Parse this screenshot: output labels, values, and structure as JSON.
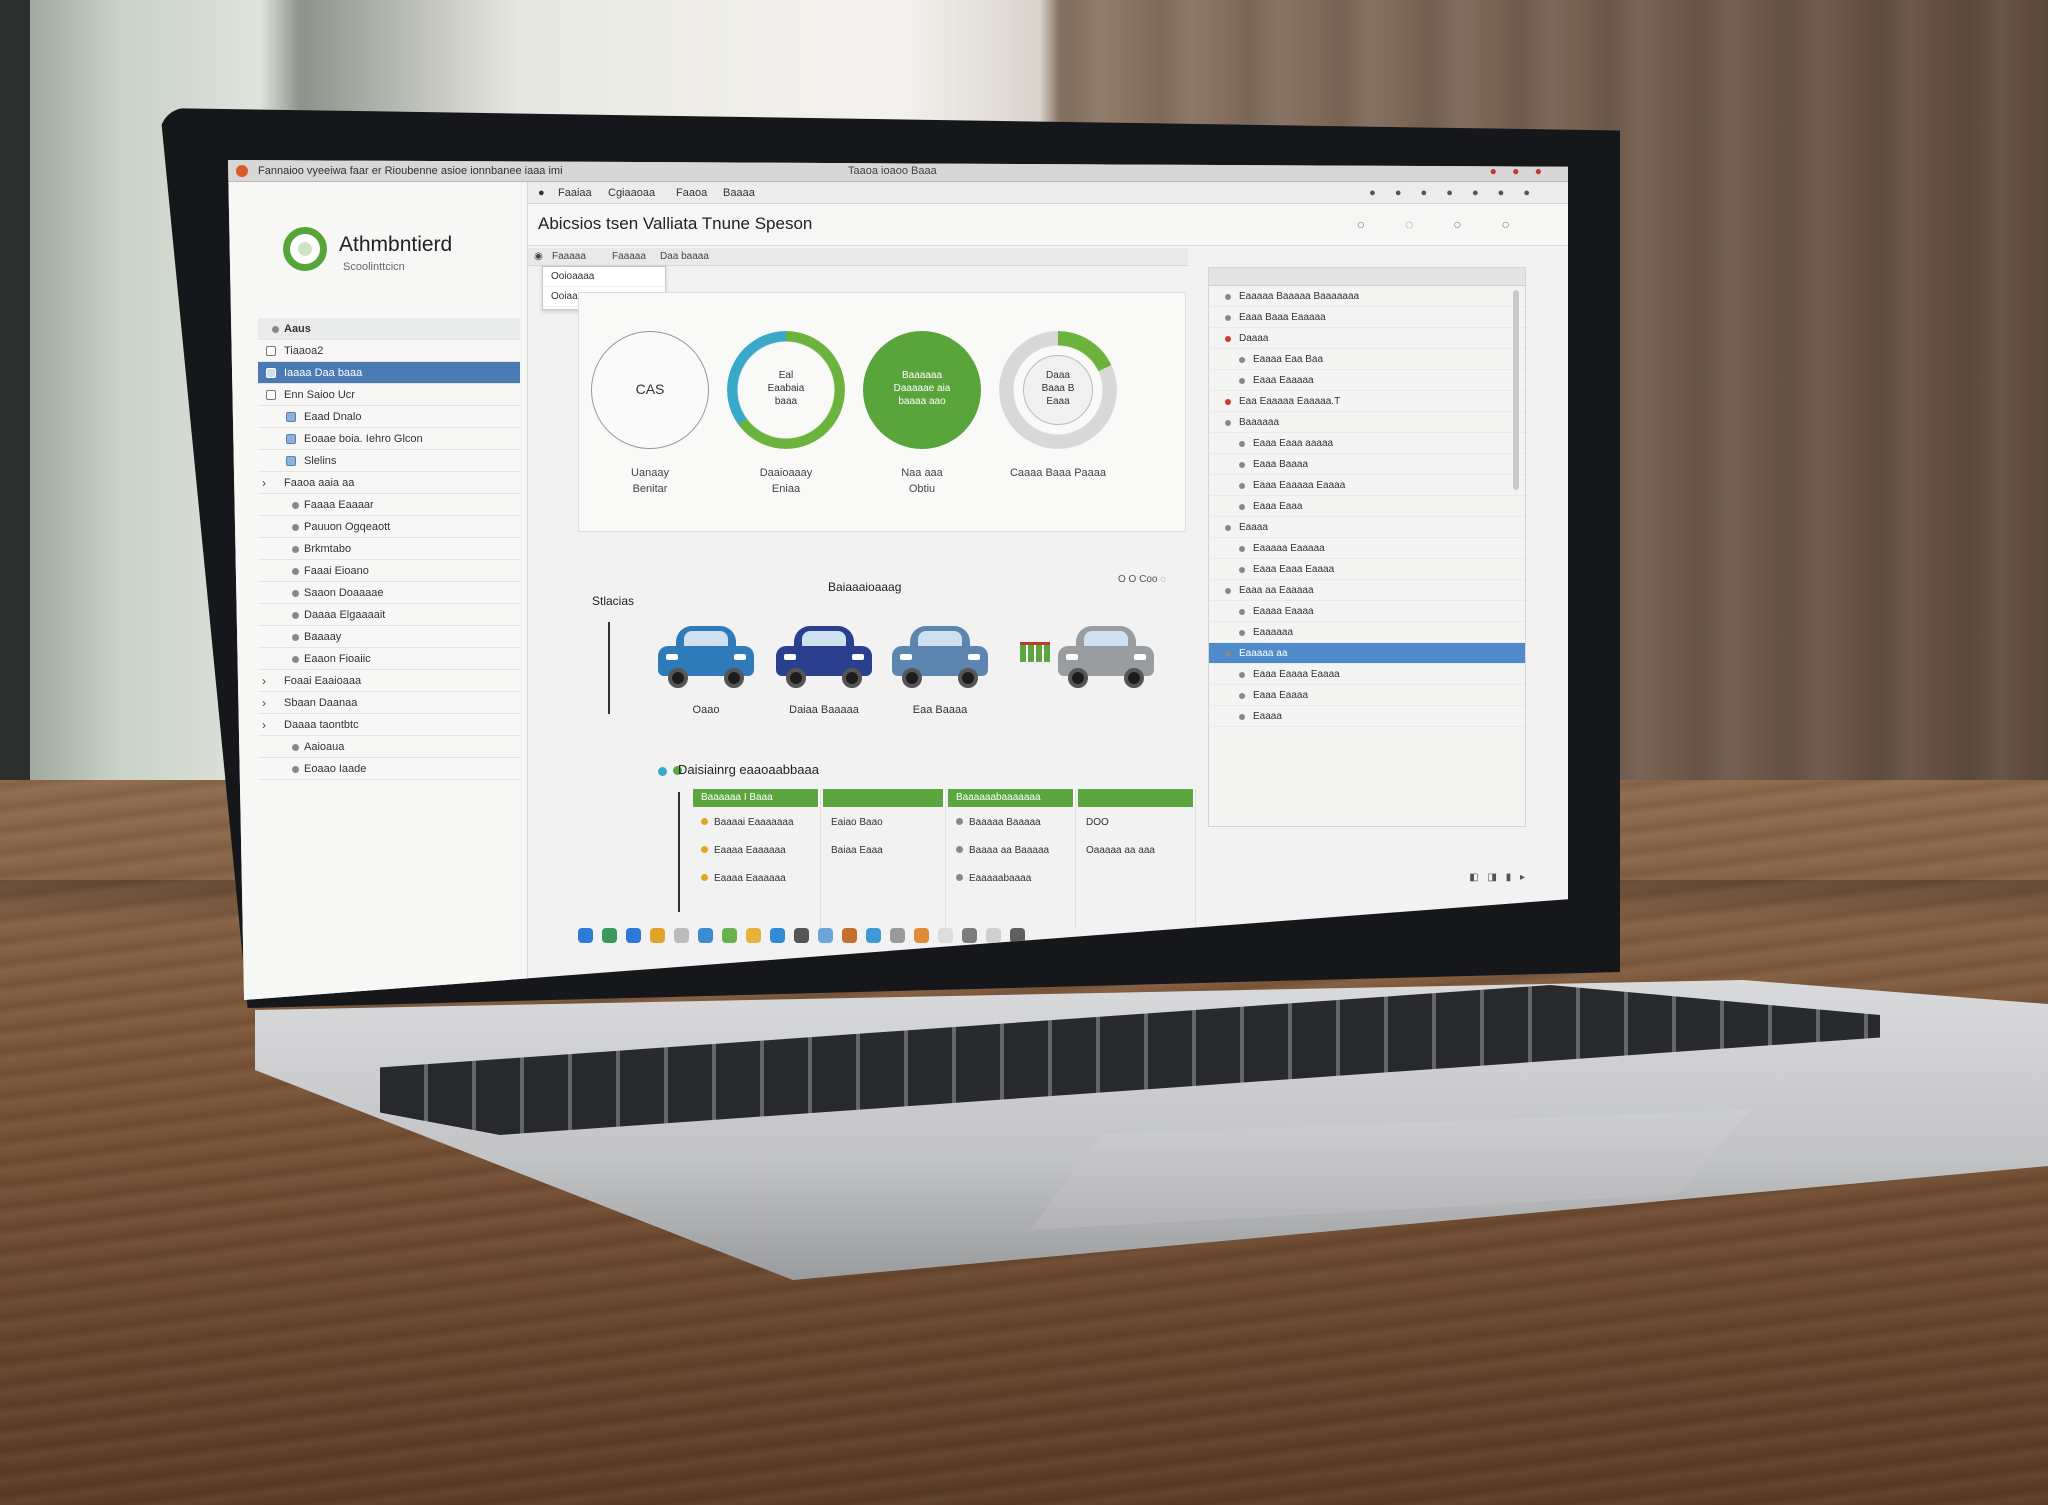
{
  "titlebar": {
    "left_text": "Fannaioo vyeeiwa faar er Rioubenne asioe ionnbanee iaaa imi",
    "center_text": "Taaoa ioaoo Baaa",
    "controls": "● ● ●"
  },
  "brand": {
    "title": "Athmbntierd",
    "subtitle": "Scoolinttcicn"
  },
  "sidebar": {
    "items": [
      {
        "label": "Aaus",
        "type": "head"
      },
      {
        "label": "Tiaaoa2",
        "type": "item"
      },
      {
        "label": "Iaaaa Daa baaa",
        "type": "selected"
      },
      {
        "label": "Enn Saioo Ucr",
        "type": "item"
      },
      {
        "label": "Eaad Dnalo",
        "type": "sub"
      },
      {
        "label": "Eoaae boia. Iehro Glcon",
        "type": "sub"
      },
      {
        "label": "Slelins",
        "type": "sub"
      },
      {
        "label": "Faaoa aaia aa",
        "type": "chev"
      },
      {
        "label": "Faaaa Eaaaar",
        "type": "bullet"
      },
      {
        "label": "Pauuon Ogqeaott",
        "type": "bullet"
      },
      {
        "label": "Brkmtabo",
        "type": "bullet"
      },
      {
        "label": "Faaai Eioano",
        "type": "bullet"
      },
      {
        "label": "Saaon Doaaaae",
        "type": "bullet"
      },
      {
        "label": "Daaaa Elgaaaait",
        "type": "bullet"
      },
      {
        "label": "Baaaay",
        "type": "bullet"
      },
      {
        "label": "Eaaon Fioaiic",
        "type": "bullet"
      },
      {
        "label": "Foaai Eaaioaaa",
        "type": "chev"
      },
      {
        "label": "Sbaan Daanaa",
        "type": "chev"
      },
      {
        "label": "Daaaa taontbtc",
        "type": "chev"
      },
      {
        "label": "Aaioaua",
        "type": "bullet"
      },
      {
        "label": "Eoaao Iaade",
        "type": "bullet"
      }
    ]
  },
  "tabs": [
    "Faaiaa",
    "Cgiaaoaa",
    "Faaoa",
    "Baaaa"
  ],
  "page_title": "Abicsios tsen Valliata Tnune Speson",
  "breadcrumb": [
    "Faaaaa",
    "Faaaaa",
    "Daa baaaa"
  ],
  "dropdown": {
    "items": [
      "Ooioaaaa",
      "Ooiaaaaaaa"
    ]
  },
  "rings": [
    {
      "center": "CAS",
      "caption_line1": "Uanaay",
      "caption_line2": "Benitar",
      "style": "outline",
      "color": "#9a9a9a",
      "value": 1.0
    },
    {
      "center": "Eal\nEaabaia\nbaaa",
      "caption_line1": "Daaioaaay",
      "caption_line2": "Eniaa",
      "style": "ring",
      "color": "#3aa9c9",
      "color2": "#6cb33e",
      "value": 0.65
    },
    {
      "center": "Baaaaaa\nDaaaaae aia\nbaaaa aao",
      "caption_line1": "Naa aaa",
      "caption_line2": "Obtiu",
      "style": "filled",
      "color": "#5aa43c",
      "value": 1.0
    },
    {
      "center": "Daaa\nBaaa B\nEaaa",
      "caption_line1": "Caaaa Baaa Paaaa",
      "caption_line2": "",
      "style": "partial",
      "color": "#6cb33e",
      "value": 0.18
    }
  ],
  "sections": {
    "vehicles_label": "Stlacias",
    "vehicles_center_label": "Baiaaaioaaag",
    "vehicles_controls": "O O Coo ◌",
    "schedule_title": "Daisiainrg eaaoaabbaaa"
  },
  "cars": [
    {
      "caption": "Oaao",
      "color": "#2f7ab8"
    },
    {
      "caption": "Daiaa Baaaaa",
      "color": "#2b3f8f"
    },
    {
      "caption": "Eaa Baaaa",
      "color": "#5c86b0"
    },
    {
      "caption": "",
      "color": "#9a9da0"
    }
  ],
  "schedule": {
    "headers": [
      "Baaaaaa I Baaa",
      "",
      "Baaaaaabaaaaaaa",
      ""
    ],
    "col1": [
      "Baaaai Eaaaaaaa",
      "Eaaaa Eaaaaaa",
      "Eaaaa Eaaaaaa"
    ],
    "col2": [
      "Eaiao Baao",
      "Baiaa Eaaa"
    ],
    "col3": [
      "Baaaaa Baaaaa",
      "Baaaa aa Baaaaa",
      "Eaaaaabaaaa"
    ],
    "col4": [
      "DOO",
      "Oaaaaa aa aaa"
    ]
  },
  "right_panel": {
    "items": [
      {
        "label": "Eaaaaa Baaaaa Baaaaaaa",
        "type": "row"
      },
      {
        "label": "Eaaa Baaa Eaaaaa",
        "type": "row"
      },
      {
        "label": "Daaaa",
        "type": "red"
      },
      {
        "label": "Eaaaa Eaa Baa",
        "type": "ind"
      },
      {
        "label": "Eaaa Eaaaaa",
        "type": "ind"
      },
      {
        "label": "Eaa Eaaaaa Eaaaaa.T",
        "type": "red"
      },
      {
        "label": "Baaaaaa",
        "type": "row"
      },
      {
        "label": "Eaaa Eaaa aaaaa",
        "type": "ind"
      },
      {
        "label": "Eaaa Baaaa",
        "type": "ind"
      },
      {
        "label": "Eaaa Eaaaaa Eaaaa",
        "type": "ind"
      },
      {
        "label": "Eaaa Eaaa",
        "type": "ind"
      },
      {
        "label": "Eaaaa",
        "type": "row"
      },
      {
        "label": "Eaaaaa Eaaaaa",
        "type": "ind"
      },
      {
        "label": "Eaaa Eaaa Eaaaa",
        "type": "ind"
      },
      {
        "label": "Eaaa aa Eaaaaa",
        "type": "row"
      },
      {
        "label": "Eaaaa Eaaaa",
        "type": "ind"
      },
      {
        "label": "Eaaaaaa",
        "type": "ind"
      },
      {
        "label": "Eaaaaa aa",
        "type": "sel"
      },
      {
        "label": "Eaaa Eaaaa Eaaaa",
        "type": "ind"
      },
      {
        "label": "Eaaa Eaaaa",
        "type": "ind"
      },
      {
        "label": "Eaaaa",
        "type": "ind"
      }
    ]
  },
  "dock": {
    "icons": [
      "#2f7ad6",
      "#3a9a5c",
      "#2a78d8",
      "#e0a42a",
      "#bbbbbb",
      "#3c8bd1",
      "#6ab04c",
      "#e5b23e",
      "#2f8bd6",
      "#555555",
      "#6aa7d8",
      "#c66f2b",
      "#3c9bd6",
      "#9a9a9a",
      "#e08b3a",
      "#dddddd",
      "#7c7c7c",
      "#cfcfcf",
      "#5f5f5f"
    ]
  },
  "colors": {
    "accent_green": "#5ba63f",
    "selection_blue": "#4a7bb5"
  }
}
